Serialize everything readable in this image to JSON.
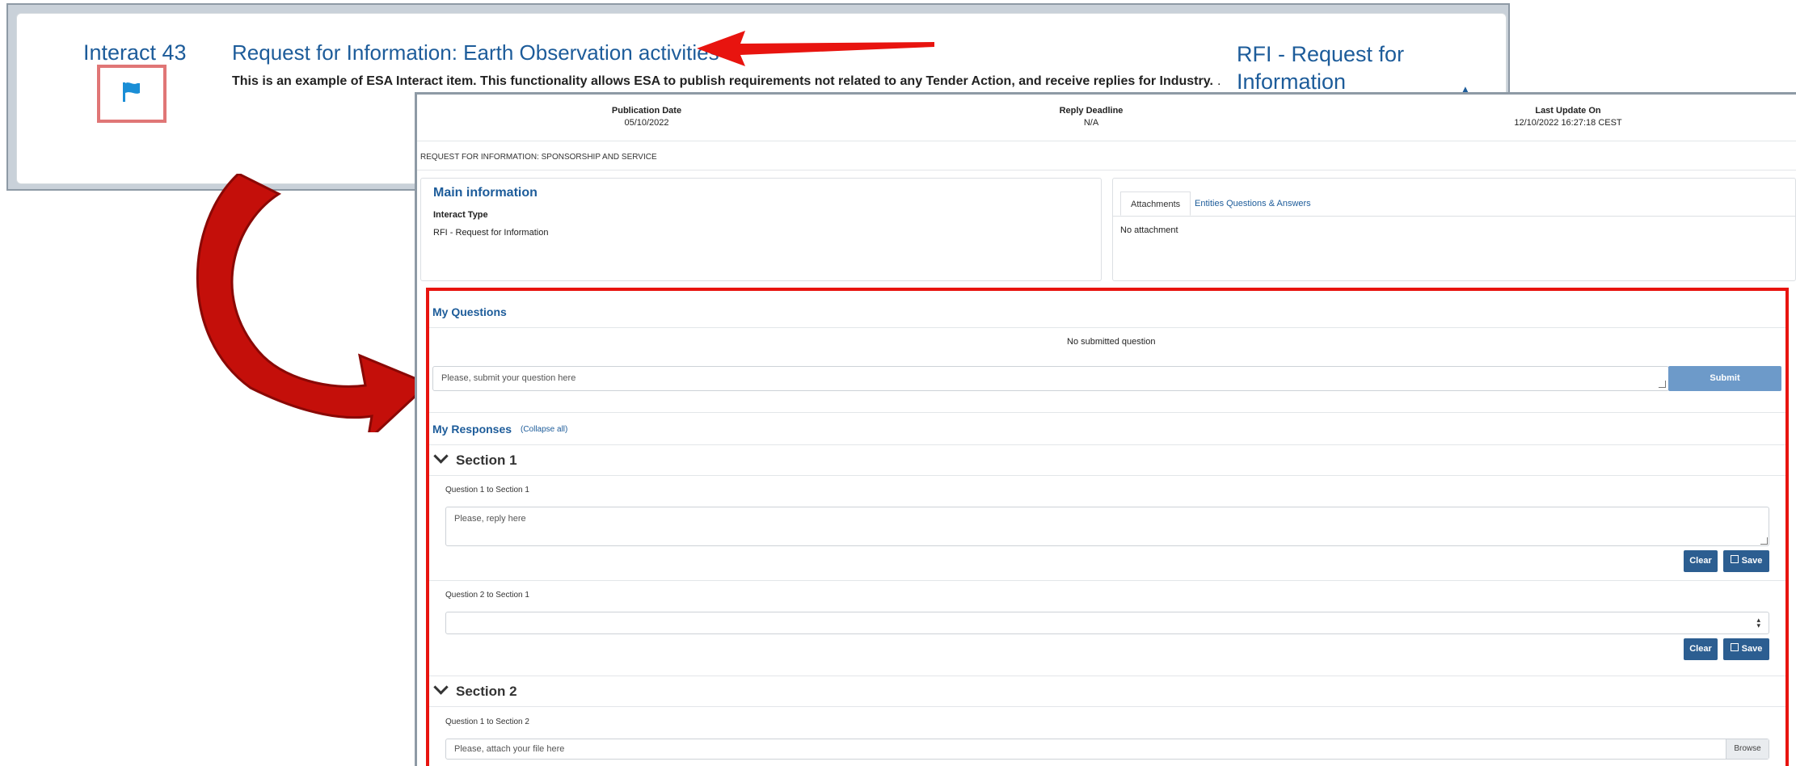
{
  "back_card": {
    "interact_id": "Interact 43",
    "title": "Request for Information: Earth Observation activities",
    "description": "This is an example of ESA Interact item. This functionality allows ESA to publish requirements not related to any Tender Action, and receive replies for Industry.",
    "type_label": "RFI - Request for Information",
    "icon": "flag-icon"
  },
  "header": {
    "publication_date_label": "Publication Date",
    "publication_date": "05/10/2022",
    "reply_deadline_label": "Reply Deadline",
    "reply_deadline": "N/A",
    "last_update_label": "Last Update On",
    "last_update": "12/10/2022 16:27:18 CEST"
  },
  "request_title": "REQUEST FOR INFORMATION: SPONSORSHIP AND SERVICE",
  "main_info": {
    "heading": "Main information",
    "interact_type_label": "Interact Type",
    "interact_type_value": "RFI - Request for Information"
  },
  "tabs": {
    "attachments": "Attachments",
    "qa": "Entities Questions & Answers",
    "no_attachment": "No attachment"
  },
  "my_questions": {
    "heading": "My Questions",
    "empty": "No submitted question",
    "placeholder": "Please, submit your question here",
    "submit": "Submit"
  },
  "my_responses": {
    "heading": "My Responses",
    "collapse": "(Collapse all)",
    "sections": [
      {
        "title": "Section 1",
        "questions": [
          {
            "label": "Question 1 to Section 1",
            "placeholder": "Please, reply here",
            "clear": "Clear",
            "save": "Save"
          },
          {
            "label": "Question 2 to Section 1",
            "clear": "Clear",
            "save": "Save"
          }
        ]
      },
      {
        "title": "Section 2",
        "questions": [
          {
            "label": "Question 1 to Section 2",
            "placeholder": "Please, attach your file here",
            "browse": "Browse"
          }
        ]
      }
    ]
  },
  "colors": {
    "accent": "#1d5c9a",
    "highlight_red": "#e8140f",
    "button": "#2c5e91",
    "submit": "#6d9ac9"
  }
}
